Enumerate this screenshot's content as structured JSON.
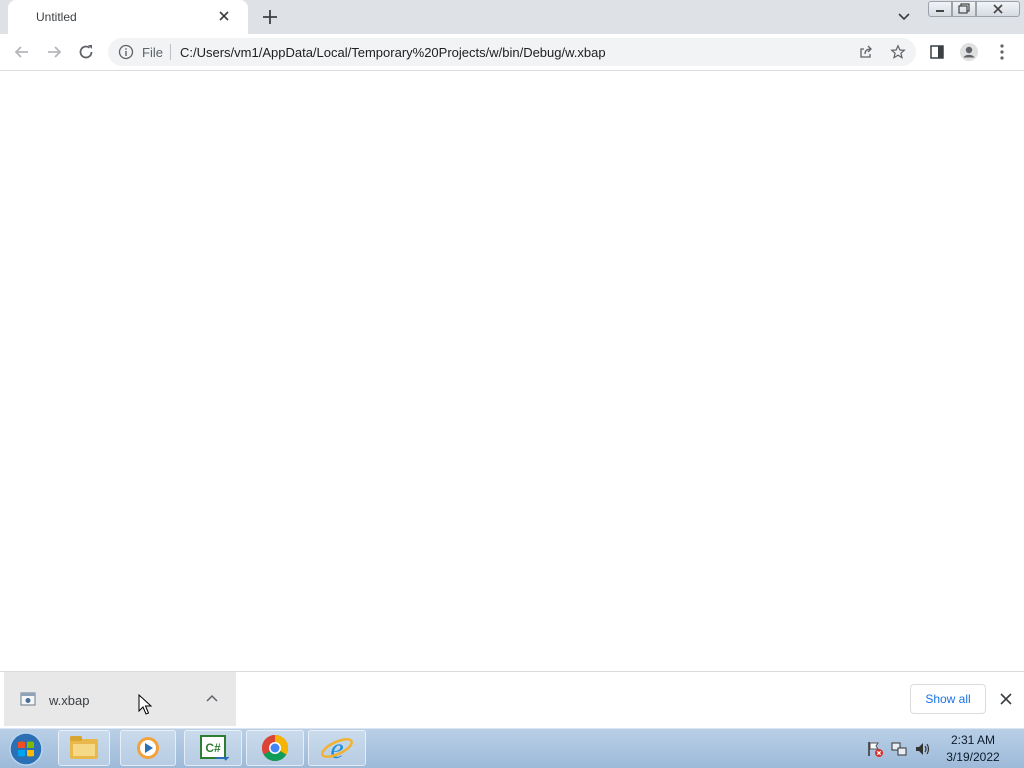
{
  "browser": {
    "tab": {
      "title": "Untitled"
    },
    "address_bar": {
      "scheme_label": "File",
      "url": "C:/Users/vm1/AppData/Local/Temporary%20Projects/w/bin/Debug/w.xbap"
    }
  },
  "download_shelf": {
    "item": {
      "filename": "w.xbap"
    },
    "show_all_label": "Show all"
  },
  "taskbar": {
    "apps": [
      {
        "name": "windows-explorer-icon"
      },
      {
        "name": "media-player-icon"
      },
      {
        "name": "visual-csharp-icon",
        "label": "C#"
      },
      {
        "name": "chrome-icon"
      },
      {
        "name": "internet-explorer-icon"
      }
    ],
    "clock": {
      "time": "2:31 AM",
      "date": "3/19/2022"
    }
  },
  "colors": {
    "tabstrip": "#dee1e6",
    "omnibox": "#f1f3f4",
    "link_blue": "#1a73e8",
    "taskbar": "#9dbad9"
  }
}
